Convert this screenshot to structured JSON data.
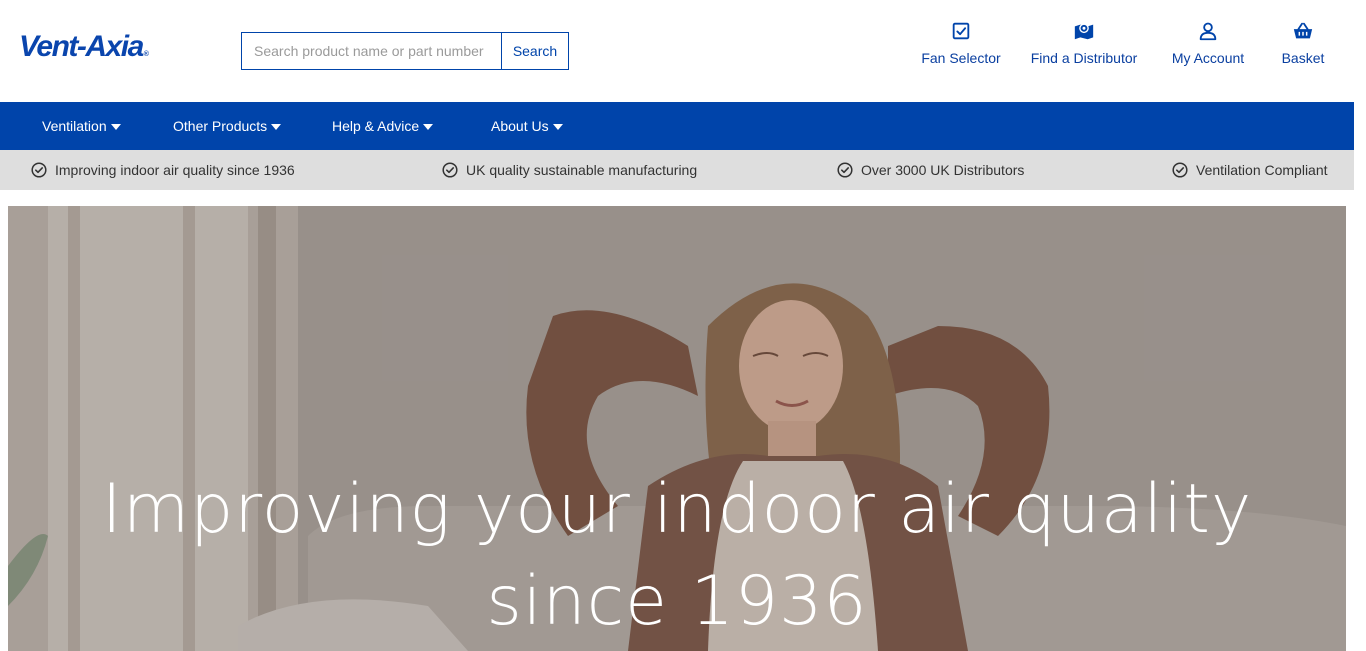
{
  "brand": {
    "name": "Vent-Axia",
    "mark": "®"
  },
  "search": {
    "placeholder": "Search product name or part number",
    "button_label": "Search"
  },
  "utility": [
    {
      "label": "Fan Selector",
      "icon": "checkbox-icon"
    },
    {
      "label": "Find a Distributor",
      "icon": "map-pin-icon"
    },
    {
      "label": "My Account",
      "icon": "user-icon"
    },
    {
      "label": "Basket",
      "icon": "basket-icon"
    }
  ],
  "nav": [
    {
      "label": "Ventilation"
    },
    {
      "label": "Other Products"
    },
    {
      "label": "Help & Advice"
    },
    {
      "label": "About Us"
    }
  ],
  "usp": [
    {
      "label": "Improving indoor air quality since 1936"
    },
    {
      "label": "UK quality sustainable manufacturing"
    },
    {
      "label": "Over 3000 UK Distributors"
    },
    {
      "label": "Ventilation Compliant"
    }
  ],
  "hero": {
    "title": "Improving your indoor air quality since 1936"
  },
  "colors": {
    "brand_blue": "#0044aa",
    "usp_bg": "#dedede",
    "hero_text": "#ffffff"
  }
}
